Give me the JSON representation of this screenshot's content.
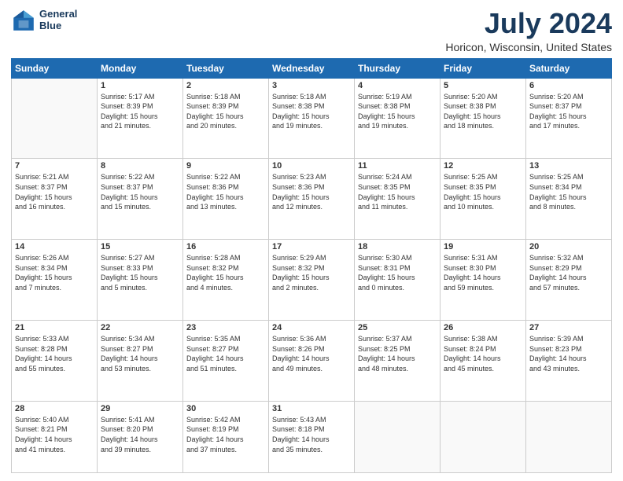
{
  "logo": {
    "line1": "General",
    "line2": "Blue"
  },
  "title": "July 2024",
  "subtitle": "Horicon, Wisconsin, United States",
  "days": [
    "Sunday",
    "Monday",
    "Tuesday",
    "Wednesday",
    "Thursday",
    "Friday",
    "Saturday"
  ],
  "weeks": [
    [
      {
        "num": "",
        "text": ""
      },
      {
        "num": "1",
        "text": "Sunrise: 5:17 AM\nSunset: 8:39 PM\nDaylight: 15 hours\nand 21 minutes."
      },
      {
        "num": "2",
        "text": "Sunrise: 5:18 AM\nSunset: 8:39 PM\nDaylight: 15 hours\nand 20 minutes."
      },
      {
        "num": "3",
        "text": "Sunrise: 5:18 AM\nSunset: 8:38 PM\nDaylight: 15 hours\nand 19 minutes."
      },
      {
        "num": "4",
        "text": "Sunrise: 5:19 AM\nSunset: 8:38 PM\nDaylight: 15 hours\nand 19 minutes."
      },
      {
        "num": "5",
        "text": "Sunrise: 5:20 AM\nSunset: 8:38 PM\nDaylight: 15 hours\nand 18 minutes."
      },
      {
        "num": "6",
        "text": "Sunrise: 5:20 AM\nSunset: 8:37 PM\nDaylight: 15 hours\nand 17 minutes."
      }
    ],
    [
      {
        "num": "7",
        "text": "Sunrise: 5:21 AM\nSunset: 8:37 PM\nDaylight: 15 hours\nand 16 minutes."
      },
      {
        "num": "8",
        "text": "Sunrise: 5:22 AM\nSunset: 8:37 PM\nDaylight: 15 hours\nand 15 minutes."
      },
      {
        "num": "9",
        "text": "Sunrise: 5:22 AM\nSunset: 8:36 PM\nDaylight: 15 hours\nand 13 minutes."
      },
      {
        "num": "10",
        "text": "Sunrise: 5:23 AM\nSunset: 8:36 PM\nDaylight: 15 hours\nand 12 minutes."
      },
      {
        "num": "11",
        "text": "Sunrise: 5:24 AM\nSunset: 8:35 PM\nDaylight: 15 hours\nand 11 minutes."
      },
      {
        "num": "12",
        "text": "Sunrise: 5:25 AM\nSunset: 8:35 PM\nDaylight: 15 hours\nand 10 minutes."
      },
      {
        "num": "13",
        "text": "Sunrise: 5:25 AM\nSunset: 8:34 PM\nDaylight: 15 hours\nand 8 minutes."
      }
    ],
    [
      {
        "num": "14",
        "text": "Sunrise: 5:26 AM\nSunset: 8:34 PM\nDaylight: 15 hours\nand 7 minutes."
      },
      {
        "num": "15",
        "text": "Sunrise: 5:27 AM\nSunset: 8:33 PM\nDaylight: 15 hours\nand 5 minutes."
      },
      {
        "num": "16",
        "text": "Sunrise: 5:28 AM\nSunset: 8:32 PM\nDaylight: 15 hours\nand 4 minutes."
      },
      {
        "num": "17",
        "text": "Sunrise: 5:29 AM\nSunset: 8:32 PM\nDaylight: 15 hours\nand 2 minutes."
      },
      {
        "num": "18",
        "text": "Sunrise: 5:30 AM\nSunset: 8:31 PM\nDaylight: 15 hours\nand 0 minutes."
      },
      {
        "num": "19",
        "text": "Sunrise: 5:31 AM\nSunset: 8:30 PM\nDaylight: 14 hours\nand 59 minutes."
      },
      {
        "num": "20",
        "text": "Sunrise: 5:32 AM\nSunset: 8:29 PM\nDaylight: 14 hours\nand 57 minutes."
      }
    ],
    [
      {
        "num": "21",
        "text": "Sunrise: 5:33 AM\nSunset: 8:28 PM\nDaylight: 14 hours\nand 55 minutes."
      },
      {
        "num": "22",
        "text": "Sunrise: 5:34 AM\nSunset: 8:27 PM\nDaylight: 14 hours\nand 53 minutes."
      },
      {
        "num": "23",
        "text": "Sunrise: 5:35 AM\nSunset: 8:27 PM\nDaylight: 14 hours\nand 51 minutes."
      },
      {
        "num": "24",
        "text": "Sunrise: 5:36 AM\nSunset: 8:26 PM\nDaylight: 14 hours\nand 49 minutes."
      },
      {
        "num": "25",
        "text": "Sunrise: 5:37 AM\nSunset: 8:25 PM\nDaylight: 14 hours\nand 48 minutes."
      },
      {
        "num": "26",
        "text": "Sunrise: 5:38 AM\nSunset: 8:24 PM\nDaylight: 14 hours\nand 45 minutes."
      },
      {
        "num": "27",
        "text": "Sunrise: 5:39 AM\nSunset: 8:23 PM\nDaylight: 14 hours\nand 43 minutes."
      }
    ],
    [
      {
        "num": "28",
        "text": "Sunrise: 5:40 AM\nSunset: 8:21 PM\nDaylight: 14 hours\nand 41 minutes."
      },
      {
        "num": "29",
        "text": "Sunrise: 5:41 AM\nSunset: 8:20 PM\nDaylight: 14 hours\nand 39 minutes."
      },
      {
        "num": "30",
        "text": "Sunrise: 5:42 AM\nSunset: 8:19 PM\nDaylight: 14 hours\nand 37 minutes."
      },
      {
        "num": "31",
        "text": "Sunrise: 5:43 AM\nSunset: 8:18 PM\nDaylight: 14 hours\nand 35 minutes."
      },
      {
        "num": "",
        "text": ""
      },
      {
        "num": "",
        "text": ""
      },
      {
        "num": "",
        "text": ""
      }
    ]
  ]
}
